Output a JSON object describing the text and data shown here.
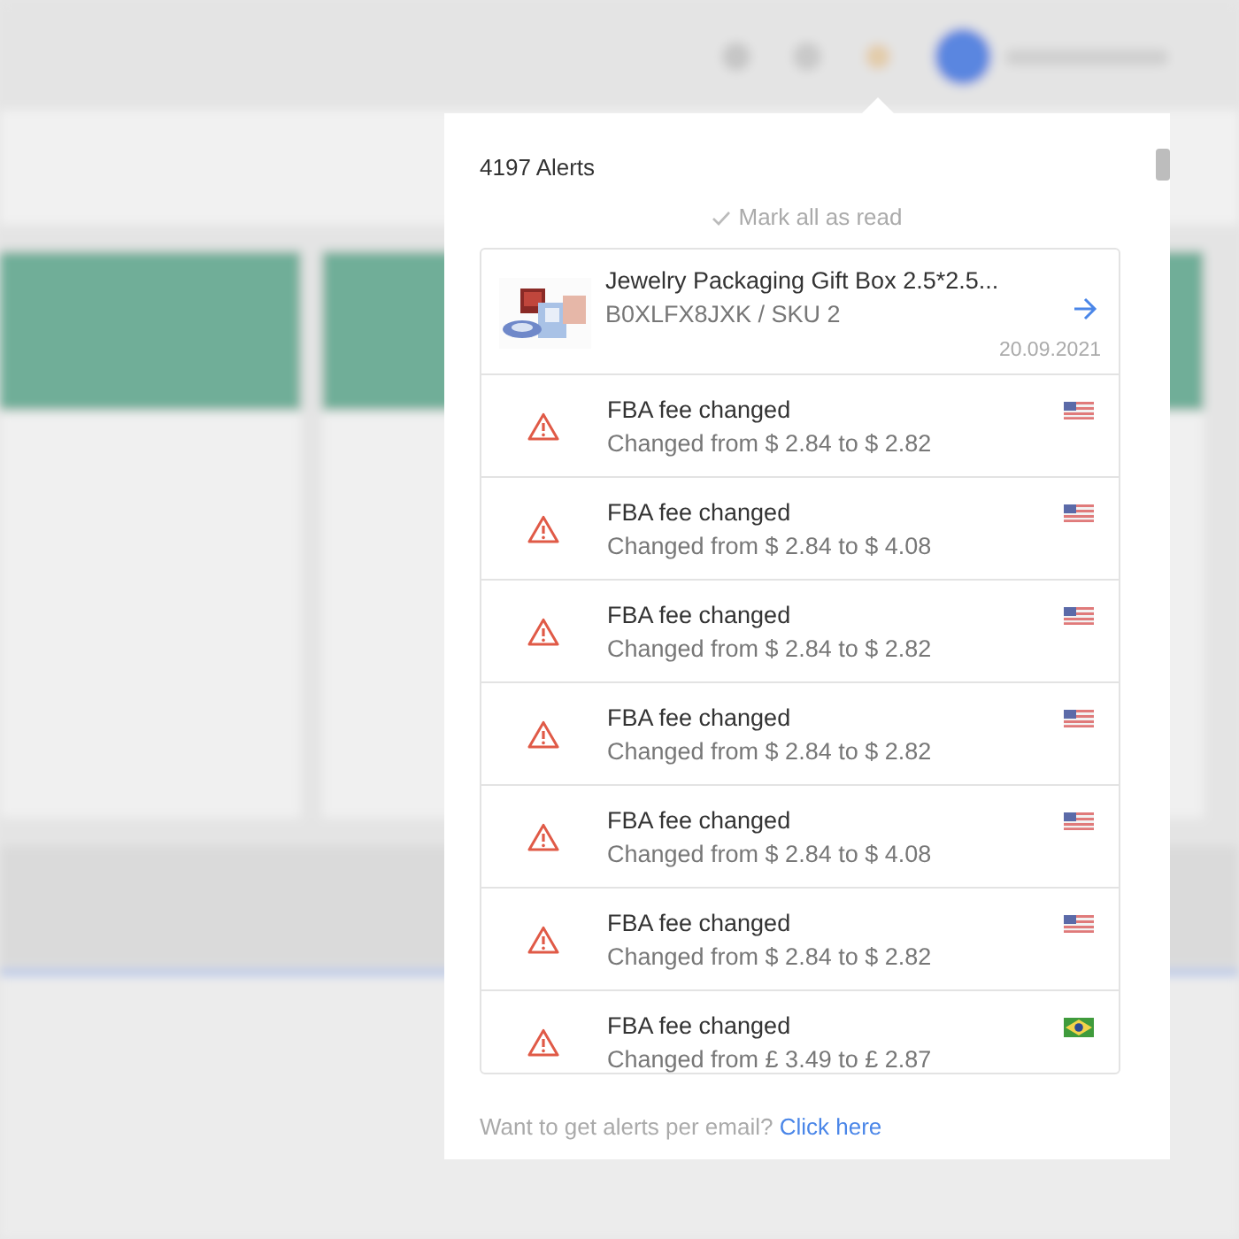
{
  "popup": {
    "title": "4197 Alerts",
    "mark_all": "Mark all as read",
    "alerts": [
      {
        "kind": "product",
        "title": "Jewelry Packaging Gift Box 2.5*2.5...",
        "subtitle": "B0XLFX8JXK / SKU 2",
        "date": "20.09.2021"
      },
      {
        "kind": "fee",
        "title": "FBA fee changed",
        "detail": "Changed from $ 2.84 to $ 2.82",
        "flag": {
          "kind": "us"
        }
      },
      {
        "kind": "fee",
        "title": "FBA fee changed",
        "detail": "Changed from $ 2.84 to $ 4.08",
        "flag": {
          "kind": "us"
        }
      },
      {
        "kind": "fee",
        "title": "FBA fee changed",
        "detail": "Changed from $ 2.84 to $ 2.82",
        "flag": {
          "kind": "us"
        }
      },
      {
        "kind": "fee",
        "title": "FBA fee changed",
        "detail": "Changed from $ 2.84 to $ 2.82",
        "flag": {
          "kind": "us"
        }
      },
      {
        "kind": "fee",
        "title": "FBA fee changed",
        "detail": "Changed from $ 2.84 to $ 4.08",
        "flag": {
          "kind": "us"
        }
      },
      {
        "kind": "fee",
        "title": "FBA fee changed",
        "detail": "Changed from $ 2.84 to $ 2.82",
        "flag": {
          "kind": "us"
        }
      },
      {
        "kind": "fee",
        "title": "FBA fee changed",
        "detail": "Changed from £ 3.49 to £ 2.87",
        "flag": {
          "kind": "br"
        }
      }
    ],
    "footer": {
      "text": "Want to get alerts per email?",
      "link": "Click here"
    }
  }
}
